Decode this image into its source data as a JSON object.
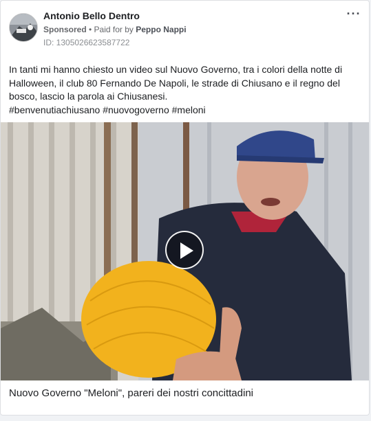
{
  "post": {
    "page_name": "Antonio Bello Dentro",
    "sponsored_label": "Sponsored",
    "separator": " • ",
    "paid_for_prefix": "Paid for by ",
    "payer": "Peppo Nappi",
    "ad_id": "ID: 1305026623587722",
    "more_icon": "more-horizontal-icon",
    "caption_line1": "In tanti mi hanno chiesto un video sul Nuovo Governo, tra i colori della notte di Halloween, il club 80 Fernando De Napoli, le strade di Chiusano e il regno del bosco, lascio la parola ai Chiusanesi.",
    "caption_hashtags": "#benvenutiachiusano #nuovogoverno #meloni"
  },
  "video": {
    "play_icon": "play-icon",
    "title": "Nuovo Governo \"Meloni\", pareri dei nostri concittadini"
  },
  "colors": {
    "text_primary": "#1c1e21",
    "text_secondary": "#65676b",
    "border": "#dddfe2",
    "background": "#f0f2f5"
  }
}
